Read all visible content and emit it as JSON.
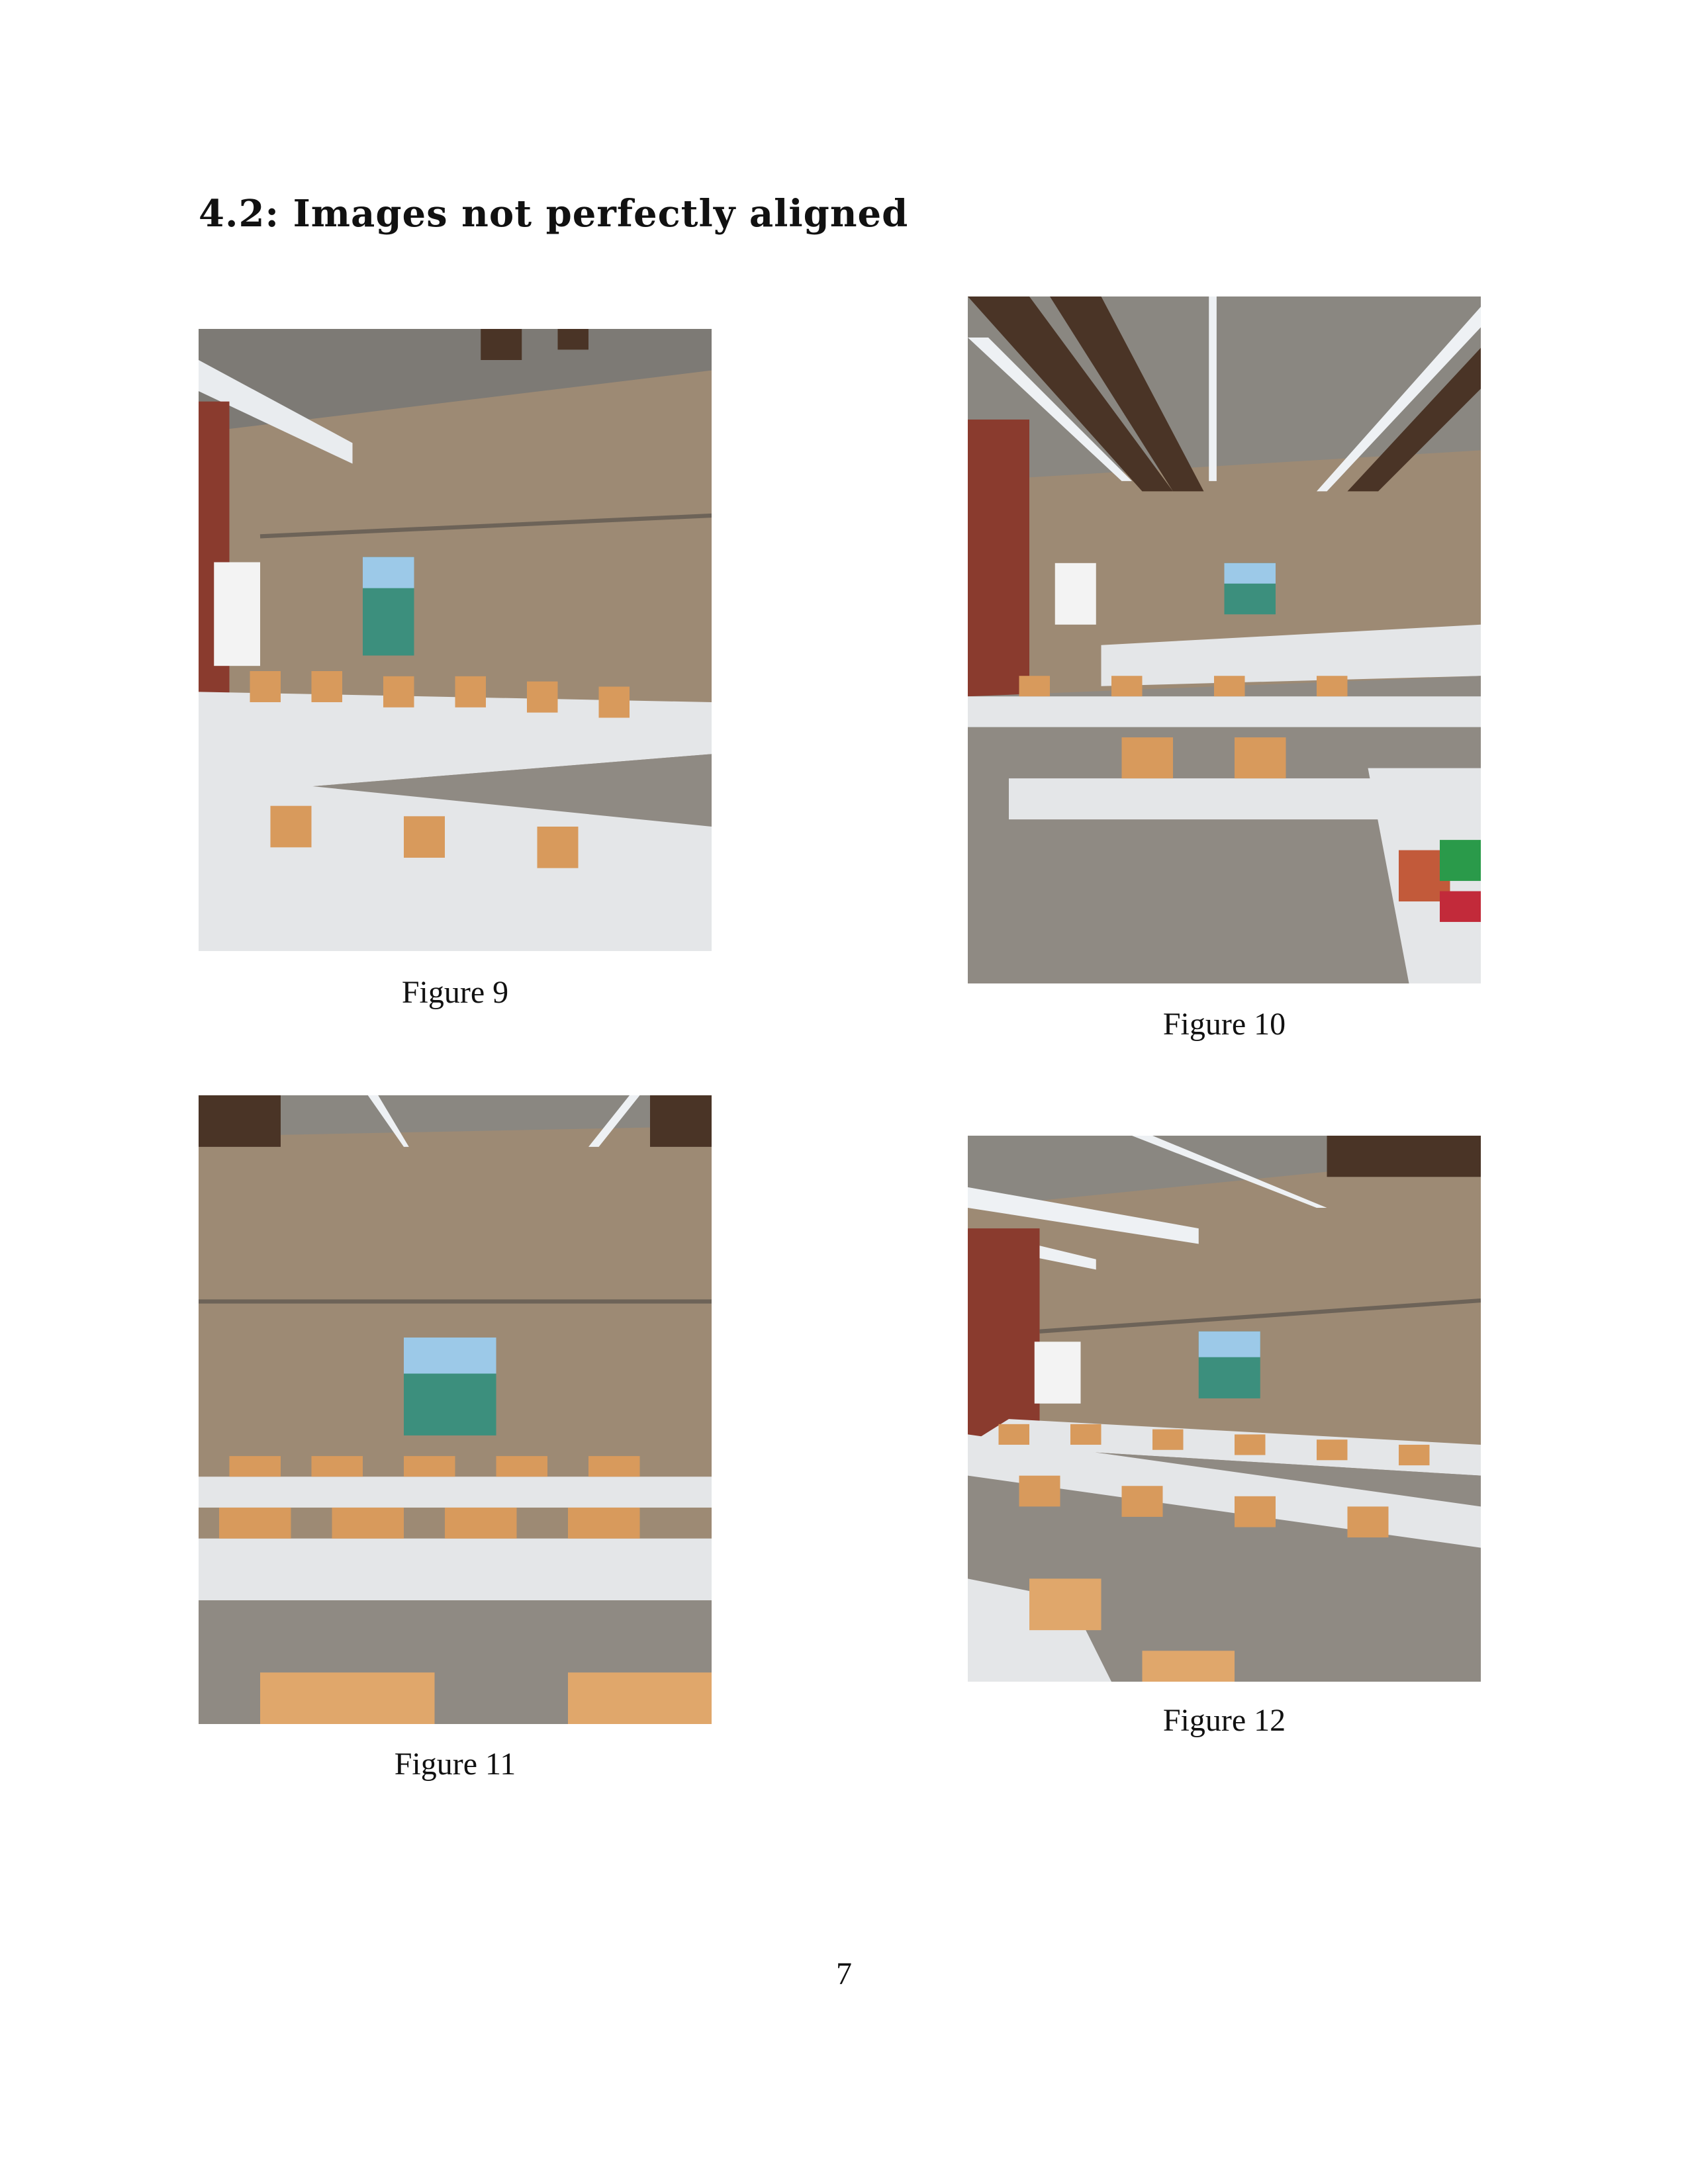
{
  "section": {
    "title": "4.2: Images not perfectly aligned"
  },
  "figures": [
    {
      "caption": "Figure 9",
      "alt": "classroom-photo"
    },
    {
      "caption": "Figure 10",
      "alt": "classroom-photo"
    },
    {
      "caption": "Figure 11",
      "alt": "classroom-photo"
    },
    {
      "caption": "Figure 12",
      "alt": "classroom-photo"
    }
  ],
  "page": {
    "number": "7"
  },
  "colors": {
    "wall": "#9d8a74",
    "ceiling": "#8a8781",
    "beam": "#4a3426",
    "desk": "#e4e6e8",
    "chair": "#d89a5c",
    "floor": "#8f8a83",
    "brick": "#8a3b2e"
  }
}
